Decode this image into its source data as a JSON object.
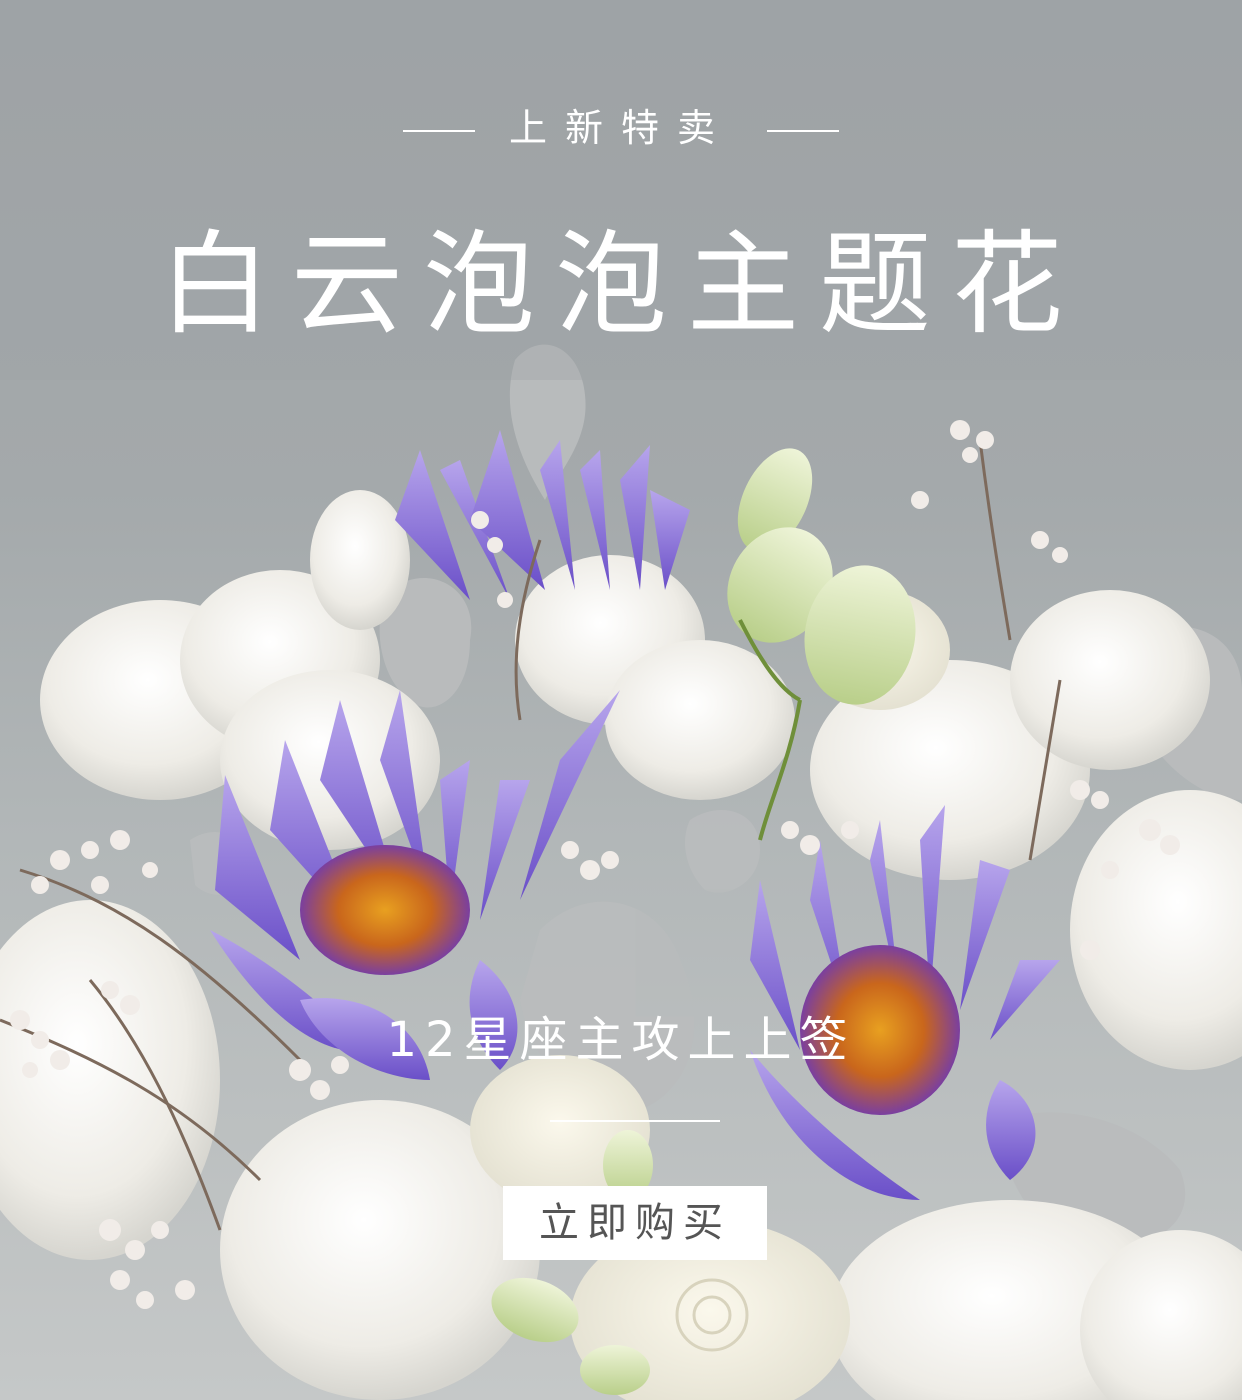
{
  "banner": {
    "eyebrow": "上新特卖",
    "title": "白云泡泡主题花",
    "subtitle": "12星座主攻上上签",
    "buy_label": "立即购买"
  },
  "colors": {
    "background": "#a3a7aa",
    "text": "#ffffff",
    "button_bg": "#ffffff",
    "button_text": "#555555",
    "lotus_petal": "#8f6fd6",
    "lotus_center": "#d07a1a",
    "white_flower": "#f3f1ec",
    "dusty_leaf": "#b9bcbd"
  },
  "image": {
    "subject": "bouquet-photo",
    "icons": [
      "water-lily-icon",
      "carnation-icon",
      "rose-icon",
      "lisianthus-bud-icon",
      "dusty-miller-leaf-icon",
      "waxflower-sprig-icon"
    ]
  }
}
